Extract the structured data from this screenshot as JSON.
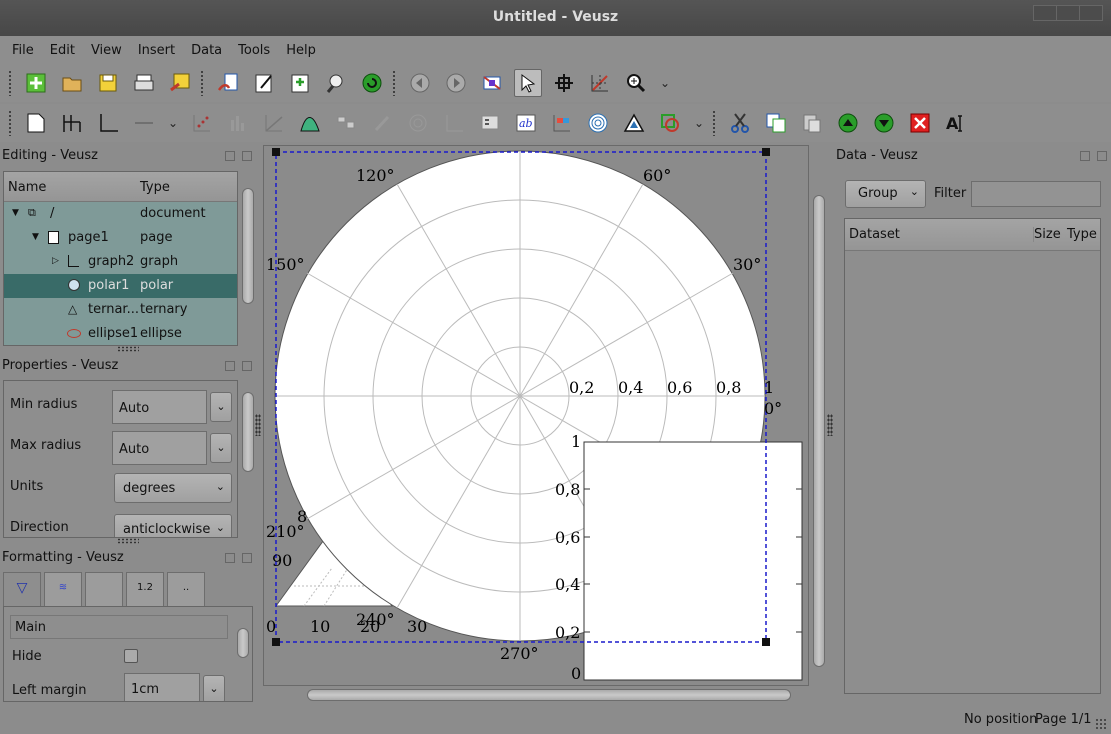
{
  "window": {
    "title": "Untitled - Veusz"
  },
  "menu": [
    "File",
    "Edit",
    "View",
    "Insert",
    "Data",
    "Tools",
    "Help"
  ],
  "toolbar1": [
    "new-document-icon",
    "open-folder-icon",
    "save-icon",
    "print-icon",
    "export-icon",
    "import-data-icon",
    "edit-data-icon",
    "create-dataset-icon",
    "capture-data-icon",
    "reload-icon",
    "previous-page-icon",
    "next-page-icon",
    "zoom-graph-icon",
    "select-pointer-icon",
    "pick-point-icon",
    "read-data-icon",
    "zoom-menu-icon"
  ],
  "toolbar2": [
    "page-icon",
    "grid-icon",
    "graph-icon",
    "axis-icon",
    "xy-plot-icon",
    "bar-plot-icon",
    "function-icon",
    "fit-icon",
    "boxplot-icon",
    "image-icon",
    "contour-icon",
    "vector-field-icon",
    "key-icon",
    "label-icon",
    "colorbar-icon",
    "polar-icon",
    "ternary-icon",
    "shape-icon",
    "cut-icon",
    "copy-icon",
    "paste-icon",
    "move-up-icon",
    "move-down-icon",
    "delete-icon",
    "rename-icon"
  ],
  "editing": {
    "title": "Editing - Veusz",
    "columns": [
      "Name",
      "Type"
    ],
    "rows": [
      {
        "name": "/",
        "type": "document"
      },
      {
        "name": "page1",
        "type": "page"
      },
      {
        "name": "graph2",
        "type": "graph"
      },
      {
        "name": "polar1",
        "type": "polar"
      },
      {
        "name": "ternar...",
        "type": "ternary"
      },
      {
        "name": "ellipse1",
        "type": "ellipse"
      }
    ]
  },
  "properties": {
    "title": "Properties - Veusz",
    "rows": [
      {
        "label": "Min radius",
        "value": "Auto"
      },
      {
        "label": "Max radius",
        "value": "Auto"
      },
      {
        "label": "Units",
        "value": "degrees"
      },
      {
        "label": "Direction",
        "value": "anticlockwise"
      }
    ]
  },
  "formatting": {
    "title": "Formatting - Veusz",
    "tabs": [
      "▽",
      "≋",
      "",
      "1.2",
      ".."
    ],
    "section": "Main",
    "hide_label": "Hide",
    "left_margin_label": "Left margin",
    "left_margin_value": "1cm"
  },
  "plot": {
    "angle_labels": [
      "120°",
      "60°",
      "150°",
      "30°",
      "0°",
      "210°",
      "240°",
      "270°"
    ],
    "radius_labels": [
      "0,2",
      "0,4",
      "0,6",
      "0,8",
      "1"
    ],
    "graph_y_labels": [
      "1",
      "0,8",
      "0,6",
      "0,4",
      "0,2",
      "0"
    ],
    "ternary_labels": [
      "0",
      "10",
      "20",
      "30",
      "90",
      "8"
    ]
  },
  "data": {
    "title": "Data - Veusz",
    "group_label": "Group",
    "filter_label": "Filter",
    "columns": [
      "Dataset",
      "Size",
      "Type"
    ]
  },
  "status": {
    "position": "No position",
    "page": "Page 1/1"
  }
}
